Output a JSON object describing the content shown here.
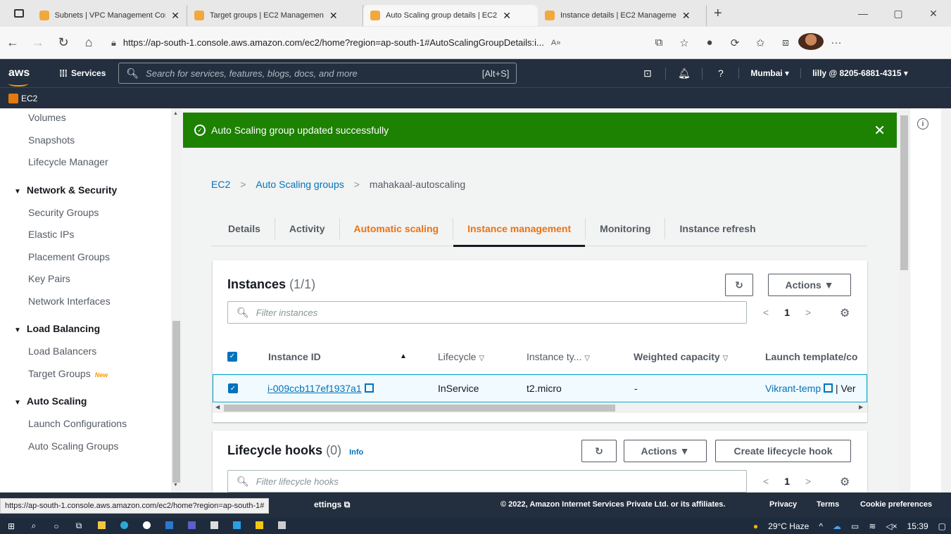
{
  "browser": {
    "tabs": [
      {
        "label": "Subnets | VPC Management Con",
        "active": false
      },
      {
        "label": "Target groups | EC2 Managemen",
        "active": false
      },
      {
        "label": "Auto Scaling group details | EC2",
        "active": true
      },
      {
        "label": "Instance details | EC2 Manageme",
        "active": false
      }
    ],
    "url": "https://ap-south-1.console.aws.amazon.com/ec2/home?region=ap-south-1#AutoScalingGroupDetails:i..."
  },
  "aws_header": {
    "logo": "aws",
    "services_label": "Services",
    "search_placeholder": "Search for services, features, blogs, docs, and more",
    "search_shortcut": "[Alt+S]",
    "region": "Mumbai ▾",
    "account": "lilly @ 8205-6881-4315 ▾",
    "service_name": "EC2"
  },
  "sidebar": {
    "top_items": [
      "Volumes",
      "Snapshots",
      "Lifecycle Manager"
    ],
    "network_security": {
      "title": "Network & Security",
      "items": [
        "Security Groups",
        "Elastic IPs",
        "Placement Groups",
        "Key Pairs",
        "Network Interfaces"
      ]
    },
    "load_balancing": {
      "title": "Load Balancing",
      "items": [
        "Load Balancers",
        "Target Groups"
      ],
      "new_badge": "New"
    },
    "auto_scaling": {
      "title": "Auto Scaling",
      "items": [
        "Launch Configurations",
        "Auto Scaling Groups"
      ]
    }
  },
  "flash": {
    "message": "Auto Scaling group updated successfully",
    "color": "#1d8102"
  },
  "breadcrumb": {
    "items": [
      "EC2",
      "Auto Scaling groups",
      "mahakaal-autoscaling"
    ]
  },
  "tabs": [
    {
      "label": "Details",
      "state": "normal"
    },
    {
      "label": "Activity",
      "state": "normal"
    },
    {
      "label": "Automatic scaling",
      "state": "highlight"
    },
    {
      "label": "Instance management",
      "state": "active"
    },
    {
      "label": "Monitoring",
      "state": "normal"
    },
    {
      "label": "Instance refresh",
      "state": "normal"
    }
  ],
  "instances_panel": {
    "title": "Instances",
    "count": "(1/1)",
    "actions_label": "Actions ▼",
    "filter_placeholder": "Filter instances",
    "page": "1",
    "columns": [
      "Instance ID",
      "Lifecycle",
      "Instance ty...",
      "Weighted capacity",
      "Launch template/co"
    ],
    "rows": [
      {
        "instance_id": "i-009ccb117ef1937a1",
        "lifecycle": "InService",
        "instance_type": "t2.micro",
        "weighted_capacity": "-",
        "launch_template": "Vikrant-temp",
        "launch_template_suffix": "| Ver"
      }
    ]
  },
  "lifecycle_panel": {
    "title": "Lifecycle hooks",
    "count": "(0)",
    "info": "Info",
    "actions_label": "Actions ▼",
    "create_label": "Create lifecycle hook",
    "filter_placeholder": "Filter lifecycle hooks",
    "page": "1"
  },
  "footer": {
    "status_url": "https://ap-south-1.console.aws.amazon.com/ec2/home?region=ap-south-1#",
    "settings": "ettings",
    "copyright": "© 2022, Amazon Internet Services Private Ltd. or its affiliates.",
    "links": [
      "Privacy",
      "Terms",
      "Cookie preferences"
    ]
  },
  "taskbar": {
    "weather": "29°C Haze",
    "time": "15:39"
  }
}
